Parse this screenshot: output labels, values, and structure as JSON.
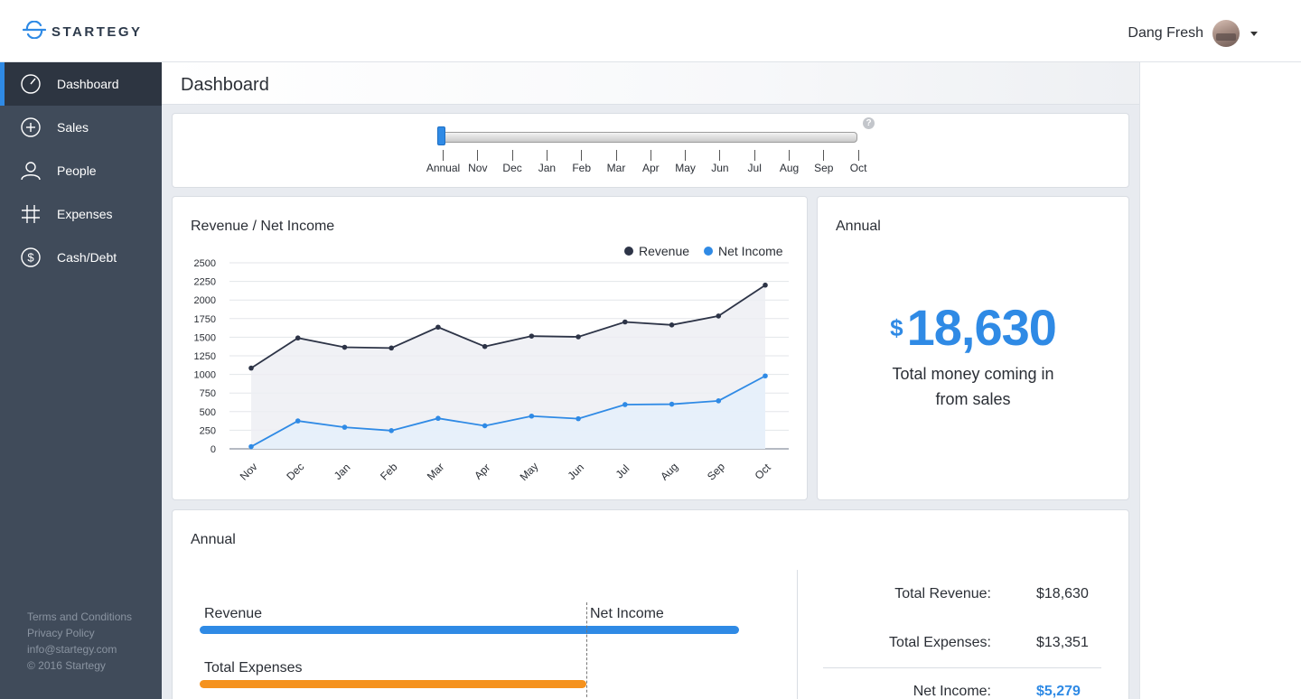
{
  "brand": {
    "name": "STARTEGY"
  },
  "user": {
    "name": "Dang Fresh"
  },
  "sidebar": {
    "items": [
      {
        "label": "Dashboard",
        "icon": "gauge-icon",
        "active": true
      },
      {
        "label": "Sales",
        "icon": "plus-circle-icon",
        "active": false
      },
      {
        "label": "People",
        "icon": "person-icon",
        "active": false
      },
      {
        "label": "Expenses",
        "icon": "hash-icon",
        "active": false
      },
      {
        "label": "Cash/Debt",
        "icon": "dollar-circle-icon",
        "active": false
      }
    ],
    "footer": [
      "Terms and Conditions",
      "Privacy Policy",
      "info@startegy.com",
      "© 2016 Startegy"
    ]
  },
  "page": {
    "title": "Dashboard"
  },
  "period_slider": {
    "labels": [
      "Annual",
      "Nov",
      "Dec",
      "Jan",
      "Feb",
      "Mar",
      "Apr",
      "May",
      "Jun",
      "Jul",
      "Aug",
      "Sep",
      "Oct"
    ],
    "selected": "Annual",
    "help": "?"
  },
  "chart_card": {
    "title": "Revenue / Net Income"
  },
  "chart_data": {
    "type": "line",
    "title": "Revenue / Net Income",
    "categories": [
      "Nov",
      "Dec",
      "Jan",
      "Feb",
      "Mar",
      "Apr",
      "May",
      "Jun",
      "Jul",
      "Aug",
      "Sep",
      "Oct"
    ],
    "series": [
      {
        "name": "Revenue",
        "color": "#2d3447",
        "values": [
          1085,
          1490,
          1365,
          1355,
          1635,
          1375,
          1515,
          1505,
          1705,
          1665,
          1785,
          2200
        ]
      },
      {
        "name": "Net Income",
        "color": "#2f8ae5",
        "values": [
          30,
          375,
          290,
          245,
          410,
          310,
          440,
          405,
          595,
          600,
          645,
          980
        ]
      }
    ],
    "yticks": [
      0,
      250,
      500,
      750,
      1000,
      1250,
      1500,
      1750,
      2000,
      2250,
      2500
    ],
    "ylim": [
      0,
      2500
    ],
    "legend": "top-right",
    "grid": true
  },
  "annual_total_card": {
    "title": "Annual",
    "currency": "$",
    "value": "18,630",
    "caption_line1": "Total money coming in",
    "caption_line2": "from sales"
  },
  "annual_card": {
    "title": "Annual",
    "bars": [
      {
        "label": "Revenue",
        "value": 18630,
        "color": "#2f8ae5"
      },
      {
        "label": "Total Expenses",
        "value": 13351,
        "color": "#f5921e"
      }
    ],
    "marker_label": "Net Income",
    "summary": [
      {
        "label": "Total Revenue:",
        "value": "$18,630"
      },
      {
        "label": "Total Expenses:",
        "value": "$13,351"
      },
      {
        "label": "Net Income:",
        "value": "$5,279",
        "highlight": "#2f8ae5"
      }
    ]
  }
}
